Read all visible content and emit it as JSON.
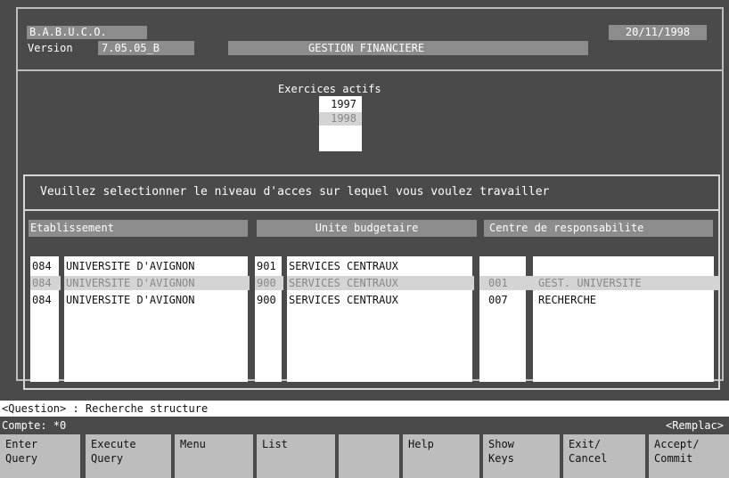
{
  "header": {
    "app_name": "B.A.B.U.C.O.",
    "version_label": "Version",
    "version_value": "7.05.05_B",
    "title": "GESTION FINANCIERE",
    "date": "20/11/1998"
  },
  "exercices": {
    "label": "Exercices actifs",
    "years": [
      "1997",
      "1998"
    ],
    "selected": "1998"
  },
  "access": {
    "prompt": "Veuillez selectionner le niveau d'acces sur lequel vous voulez travailler",
    "columns": [
      "Etablissement",
      "Unite budgetaire",
      "Centre de responsabilite"
    ],
    "rows": [
      {
        "etab_code": "084",
        "etab_name": "UNIVERSITE D'AVIGNON",
        "ub_code": "901",
        "ub_name": "SERVICES CENTRAUX",
        "cr_code": "",
        "cr_name": ""
      },
      {
        "etab_code": "084",
        "etab_name": "UNIVERSITE D'AVIGNON",
        "ub_code": "900",
        "ub_name": "SERVICES CENTRAUX",
        "cr_code": "001",
        "cr_name": "GEST. UNIVERSITE"
      },
      {
        "etab_code": "084",
        "etab_name": "UNIVERSITE D'AVIGNON",
        "ub_code": "900",
        "ub_name": "SERVICES CENTRAUX",
        "cr_code": "007",
        "cr_name": "RECHERCHE"
      }
    ]
  },
  "status": {
    "question": "<Question> : Recherche structure",
    "count": "Compte: *0",
    "mode": "<Remplac>"
  },
  "function_keys": [
    {
      "line1": "Enter",
      "line2": "Query"
    },
    {
      "line1": "Execute",
      "line2": "Query"
    },
    {
      "line1": "Menu",
      "line2": ""
    },
    {
      "line1": "List",
      "line2": ""
    },
    {
      "line1": "",
      "line2": ""
    },
    {
      "line1": "Help",
      "line2": ""
    },
    {
      "line1": "Show",
      "line2": "Keys"
    },
    {
      "line1": "Exit/",
      "line2": "Cancel"
    },
    {
      "line1": "Accept/",
      "line2": "Commit"
    }
  ],
  "colors": {
    "background": "#4a4a4a",
    "field": "#8c8c8c",
    "selected_row": "#d4d4d4",
    "panel_border": "#d6d6d6"
  }
}
